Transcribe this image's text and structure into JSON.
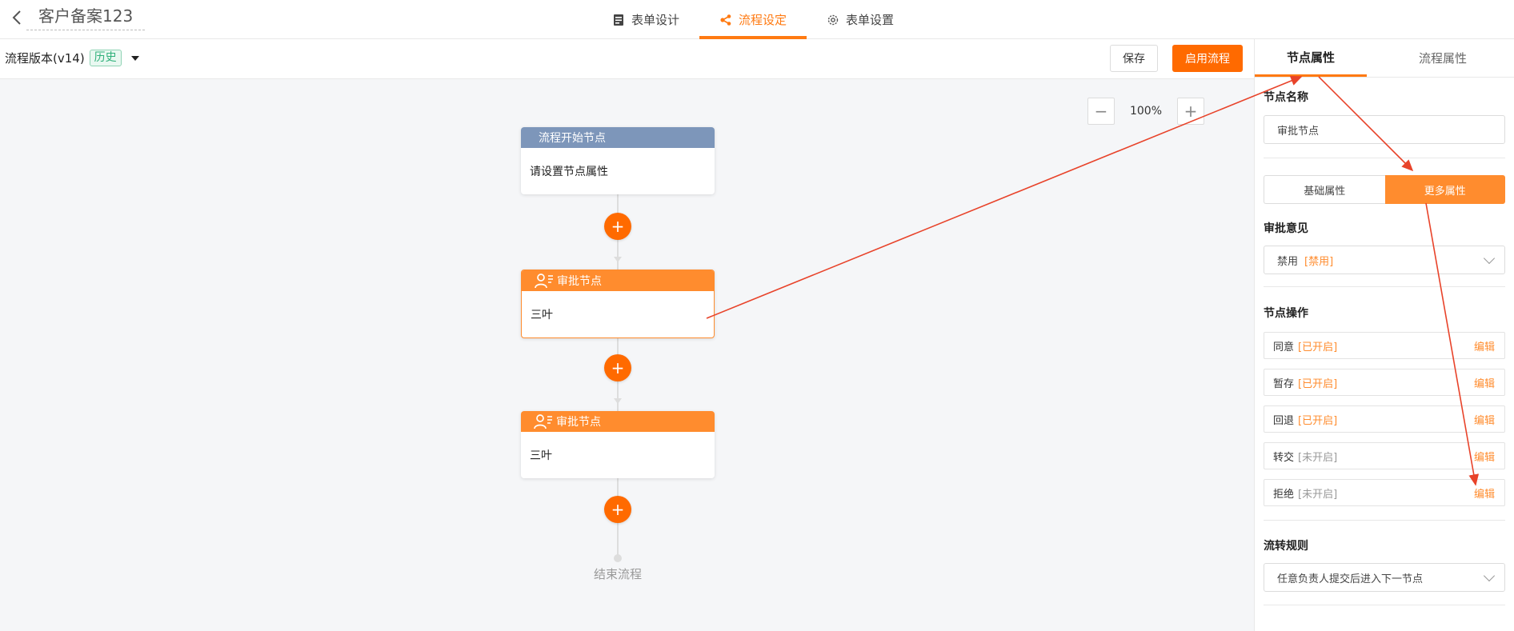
{
  "app": {
    "title": "客户备案123"
  },
  "top_tabs": [
    {
      "label": "表单设计",
      "icon": "form-icon"
    },
    {
      "label": "流程设定",
      "icon": "flow-icon"
    },
    {
      "label": "表单设置",
      "icon": "gear-icon"
    }
  ],
  "toolbar": {
    "version_label": "流程版本(v14)",
    "history_badge": "历史",
    "save_label": "保存",
    "start_label": "启用流程"
  },
  "canvas": {
    "zoom_minus": "−",
    "zoom_value": "100%",
    "zoom_plus": "+",
    "start_node": {
      "title": "流程开始节点",
      "body": "请设置节点属性"
    },
    "approve_nodes": [
      {
        "title": "审批节点",
        "body": "三叶"
      },
      {
        "title": "审批节点",
        "body": "三叶"
      }
    ],
    "add_symbol": "+",
    "end_label": "结束流程"
  },
  "panel": {
    "tabs": [
      "节点属性",
      "流程属性"
    ],
    "node_name_title": "节点名称",
    "node_name_value": "审批节点",
    "seg_basic": "基础属性",
    "seg_more": "更多属性",
    "opinion_title": "审批意见",
    "opinion_value": "禁用",
    "opinion_tag": "[禁用]",
    "ops_title": "节点操作",
    "ops": [
      {
        "label": "同意",
        "status": "[已开启]",
        "enabled": true,
        "edit": "编辑"
      },
      {
        "label": "暂存",
        "status": "[已开启]",
        "enabled": true,
        "edit": "编辑"
      },
      {
        "label": "回退",
        "status": "[已开启]",
        "enabled": true,
        "edit": "编辑"
      },
      {
        "label": "转交",
        "status": "[未开启]",
        "enabled": false,
        "edit": "编辑"
      },
      {
        "label": "拒绝",
        "status": "[未开启]",
        "enabled": false,
        "edit": "编辑"
      }
    ],
    "rule_title": "流转规则",
    "rule_value": "任意负责人提交后进入下一节点"
  },
  "colors": {
    "accent": "#ff6a00",
    "approve_header": "#ff8c2e",
    "start_header": "#7d96ba",
    "annotation": "#e8432a"
  }
}
